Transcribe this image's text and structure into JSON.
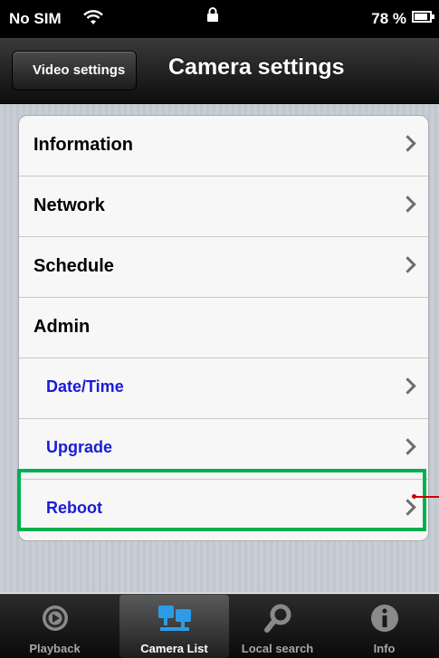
{
  "status": {
    "carrier": "No SIM",
    "battery": "78 %"
  },
  "navbar": {
    "back_label": "Video settings",
    "title": "Camera settings"
  },
  "settings": {
    "items": [
      {
        "label": "Information",
        "chevron": true
      },
      {
        "label": "Network",
        "chevron": true
      },
      {
        "label": "Schedule",
        "chevron": true
      },
      {
        "label": "Admin",
        "chevron": false
      },
      {
        "label": "Date/Time",
        "chevron": true
      },
      {
        "label": "Upgrade",
        "chevron": true
      },
      {
        "label": "Reboot",
        "chevron": true
      }
    ]
  },
  "tabbar": {
    "tabs": [
      {
        "label": "Playback",
        "icon": "playback-icon"
      },
      {
        "label": "Camera List",
        "icon": "camera-list-icon",
        "active": true
      },
      {
        "label": "Local search",
        "icon": "search-icon"
      },
      {
        "label": "Info",
        "icon": "info-icon"
      }
    ]
  },
  "colors": {
    "highlight": "#00b050",
    "pointer": "#d00000",
    "sub_item_text": "#1a1adb"
  }
}
